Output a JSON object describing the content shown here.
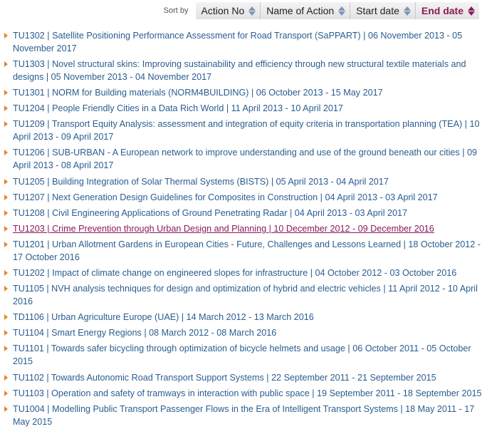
{
  "sortbar": {
    "label": "Sort by",
    "buttons": [
      {
        "label": "Action No",
        "active": false
      },
      {
        "label": "Name of Action",
        "active": false
      },
      {
        "label": "Start date",
        "active": false
      },
      {
        "label": "End date",
        "active": true
      }
    ]
  },
  "colors": {
    "link": "#2a5d8f",
    "visited_link": "#8b1a5a",
    "bullet": "#e8832a",
    "sort_arrow": "#7f93b3"
  },
  "actions": [
    {
      "text": "TU1302 | Satellite Positioning Performance Assessment for Road Transport (SaPPART) | 06 November 2013 - 05 November 2017"
    },
    {
      "text": "TU1303 | Novel structural skins: Improving sustainability and efficiency through new structural textile materials and designs  | 05 November 2013 - 04 November 2017"
    },
    {
      "text": "TU1301 | NORM for Building materials (NORM4BUILDING) | 06 October 2013 - 15 May 2017"
    },
    {
      "text": "TU1204 | People Friendly Cities in a Data Rich World | 11 April 2013 - 10 April 2017"
    },
    {
      "text": "TU1209 | Transport Equity Analysis: assessment and integration of equity criteria in transportation planning (TEA) | 10 April 2013 - 09 April 2017"
    },
    {
      "text": "TU1206 | SUB-URBAN - A European network to improve understanding and use of the ground beneath our cities | 09 April 2013 - 08 April 2017"
    },
    {
      "text": "TU1205 | Building Integration of Solar Thermal Systems (BISTS) | 05 April 2013 - 04 April 2017"
    },
    {
      "text": "TU1207 | Next Generation Design Guidelines for Composites in Construction | 04 April 2013 - 03 April 2017"
    },
    {
      "text": "TU1208 | Civil Engineering Applications of Ground Penetrating Radar | 04 April 2013 - 03 April 2017"
    },
    {
      "text": "TU1203 | Crime Prevention through Urban Design and Planning | 10 December 2012 - 09 December 2016",
      "visited": true
    },
    {
      "text": "TU1201 | Urban Allotment Gardens in European Cities - Future, Challenges and Lessons Learned | 18 October 2012 - 17 October 2016"
    },
    {
      "text": "TU1202 | Impact of climate change on engineered slopes for infrastructure | 04 October 2012 - 03 October 2016"
    },
    {
      "text": "TU1105 | NVH analysis techniques for design and optimization of hybrid and electric vehicles | 11 April 2012 - 10 April 2016"
    },
    {
      "text": "TD1106 | Urban Agriculture Europe (UAE) | 14 March 2012 - 13 March 2016"
    },
    {
      "text": "TU1104 | Smart Energy Regions | 08 March 2012 - 08 March 2016"
    },
    {
      "text": "TU1101 | Towards safer bicycling through optimization of bicycle helmets and usage | 06 October 2011 - 05 October 2015"
    },
    {
      "text": "TU1102 | Towards Autonomic Road Transport Support Systems | 22 September 2011 - 21 September 2015"
    },
    {
      "text": "TU1103 | Operation and safety of tramways in interaction with public space | 19 September 2011 - 18 September 2015"
    },
    {
      "text": "TU1004 | Modelling Public Transport Passenger Flows in the Era of Intelligent Transport Systems | 18 May 2011 - 17 May 2015"
    }
  ]
}
